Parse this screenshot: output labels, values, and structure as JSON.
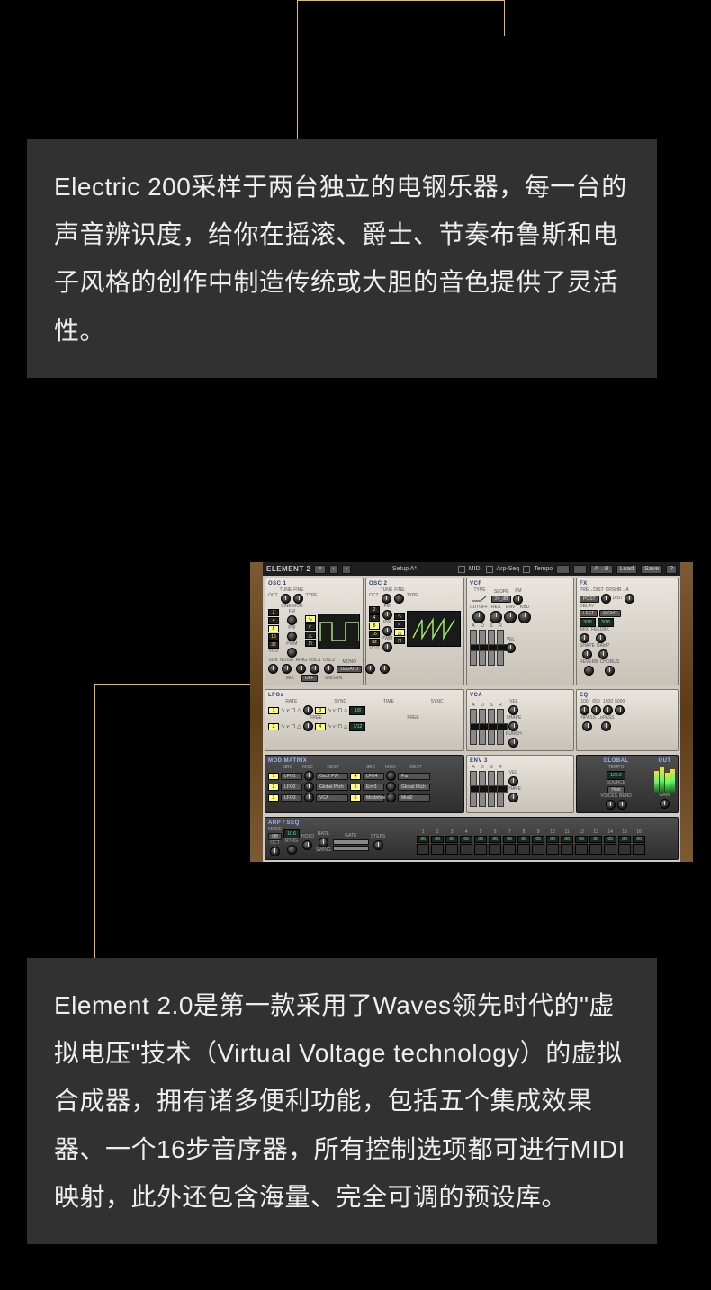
{
  "decor": {},
  "panel1": {
    "text": "Electric 200采样于两台独立的电钢乐器，每一台的声音辨识度，给你在摇滚、爵士、节奏布鲁斯和电子风格的创作中制造传统或大胆的音色提供了灵活性。"
  },
  "panel2": {
    "text": "Element 2.0是第一款采用了Waves领先时代的\"虚拟电压\"技术（Virtual Voltage technology）的虚拟合成器，拥有诸多便利功能，包括五个集成效果器、一个16步音序器，所有控制选项都可进行MIDI映射，此外还包含海量、完全可调的预设库。"
  },
  "synth": {
    "title": "ELEMENT 2",
    "preset": "Setup A*",
    "undo_btn": "←",
    "redo_btn": "→",
    "ab_btn": "A→B",
    "load_btn": "Load",
    "save_btn": "Save",
    "check_midi": "MIDI",
    "check_arpseq": "Arp-Seq",
    "check_tempo": "Tempo",
    "osc1": {
      "title": "OSC 1",
      "labels": [
        "OCT",
        "TUNE",
        "FINE",
        "TYPE"
      ],
      "nums": [
        "2",
        "4",
        "8",
        "16",
        "32"
      ],
      "sel": "8",
      "wave_sel": 0,
      "sub_labels": [
        "SUB",
        "NOISE",
        "RING",
        "OSC1",
        "OSC2",
        "MONO",
        "RTRG",
        "PORT"
      ],
      "mix": "MIX",
      "legato": "LEGATO",
      "off": "OFF",
      "unison": "UNISON",
      "vco": "VCO",
      "sine": "SINE MOD",
      "fm": "FM",
      "pw": "PW",
      "pwm": "PWM"
    },
    "osc2": {
      "title": "OSC 2",
      "labels": [
        "OCT",
        "TUNE",
        "FINE",
        "TYPE"
      ],
      "nums": [
        "2",
        "4",
        "8",
        "16",
        "32"
      ],
      "sel": "8",
      "wave_sel": 2
    },
    "vcf": {
      "title": "VCF",
      "labels": [
        "TYPE",
        "SLOPE",
        "FM",
        "CUTOFF",
        "RES",
        "ENV",
        "KBD",
        "A",
        "D",
        "S",
        "R",
        "VEL"
      ],
      "slope": "24_dB"
    },
    "fx": {
      "title": "FX",
      "labels": [
        "PRE→DIST",
        "CRSHR→A",
        "DIST",
        "DELAY",
        "LEFT",
        "RIGHT",
        "3/16",
        "3/16",
        "MIX",
        "FEEDBK",
        "SHAPE",
        "DAMP",
        "REVERB",
        "CHORUS"
      ]
    },
    "lfos": {
      "title": "LFOs",
      "nums": [
        "1",
        "2",
        "3",
        "4"
      ],
      "labels": [
        "RATE",
        "SYNC",
        "TIME",
        "SYNC",
        "FREE",
        "FREE",
        "1/8",
        "1/12"
      ]
    },
    "vca": {
      "title": "VCA",
      "labels": [
        "A",
        "D",
        "S",
        "R",
        "VEL",
        "SHAPE",
        "PUNCH"
      ]
    },
    "eq": {
      "title": "EQ",
      "labels": [
        "100",
        "650",
        "1500",
        "5000",
        "HIPASS",
        "LoPASS"
      ]
    },
    "modmatrix": {
      "title": "MOD MATRIX",
      "cols": [
        "SRC",
        "MOD",
        "DEST",
        "SRC",
        "MOD",
        "DEST"
      ],
      "rows": [
        {
          "n": "1",
          "src": "LFO1",
          "dest": "Osc2 PW",
          "n2": "4",
          "src2": "LFO4",
          "dest2": "Pan"
        },
        {
          "n": "2",
          "src": "LFO2",
          "dest": "Global Pitch",
          "n2": "5",
          "src2": "Env3",
          "dest2": "Global Pitch"
        },
        {
          "n": "3",
          "src": "LFO3",
          "dest": "VCA",
          "n2": "6",
          "src2": "Modwheel",
          "dest2": "Mod2"
        }
      ]
    },
    "env3": {
      "title": "ENV 3",
      "labels": [
        "A",
        "D",
        "S",
        "R",
        "VEL",
        "SHAPE"
      ]
    },
    "global": {
      "title": "GLOBAL",
      "tempo_lbl": "TEMPO",
      "tempo": "120.0",
      "source_lbl": "SOURCE",
      "source": "Host",
      "voices": "VOICES",
      "bend": "BEND"
    },
    "out": {
      "title": "OUT",
      "gain": "GAIN"
    },
    "arp": {
      "title": "ARP / SEQ",
      "mode_lbl": "MODE",
      "mode": "Off",
      "sync": "1/16",
      "oct": "OCT",
      "rtrg": "RTRG",
      "hold": "HOLD",
      "rate": "RATE",
      "gate": "GATE",
      "steps": "STEPS",
      "swing": "SWING",
      "step_nums": [
        "1",
        "2",
        "3",
        "4",
        "5",
        "6",
        "7",
        "8",
        "9",
        "10",
        "11",
        "12",
        "13",
        "14",
        "15",
        "16"
      ],
      "step_vals": [
        "00",
        "00",
        "00",
        "00",
        "00",
        "00",
        "00",
        "00",
        "00",
        "00",
        "00",
        "00",
        "00",
        "00",
        "00",
        "00"
      ]
    }
  }
}
